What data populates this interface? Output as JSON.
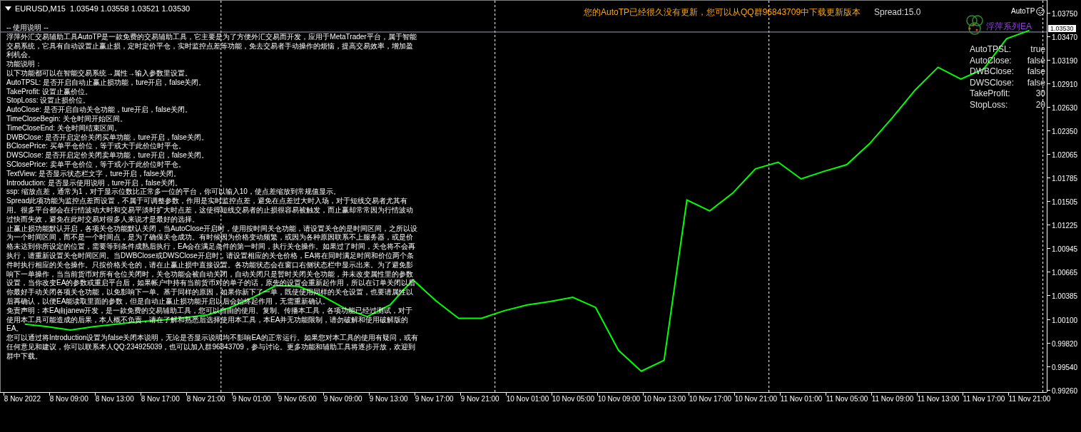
{
  "chart_header": {
    "title": "EURUSD,M15  1.03549 1.03558 1.03521 1.03530"
  },
  "update_notice": "您的AutoTP已经很久没有更新，您可以从QQ群96843709中下载更新版本",
  "spread": "Spread:15.0",
  "ea_name": "AutoTP",
  "logo_text": "浮萍系列EA",
  "instructions": [
    "-- 使用说明 --",
    "浮萍外汇交易辅助工具AutoTP是一款免费的交易辅助工具，它主要是为了方便外汇交易而开发，应用于MetaTrader平台，属于智能交易系统，它具有自动设置止赢止损，定时定价平仓，实时监控点差等功能，免去交易者手动操作的烦恼，提高交易效率，增加盈利机会。",
    "功能说明：",
    "以下功能都可以在智能交易系统→属性→输入参数里设置。",
    "AutoTPSL: 是否开启自动止赢止损功能，ture开启，false关闭。",
    "TakeProfit: 设置止赢价位。",
    "StopLoss: 设置止损价位。",
    "AutoClose: 是否开启自动关仓功能，ture开启，false关闭。",
    "TimeCloseBegin: 关仓时间开始区间。",
    "TimeCloseEnd: 关仓时间结束区间。",
    "DWBClose: 是否开启定价关闭买单功能，ture开启，false关闭。",
    "BClosePrice: 买单平仓价位，等于或大于此价位时平仓。",
    "DWSClose: 是否开启定价关闭卖单功能，ture开启，false关闭。",
    "SClosePrice: 卖单平仓价位，等于或小于此价位时平仓。",
    "TextView: 是否显示状态栏文字，ture开启，false关闭。",
    "Introduction: 是否显示使用说明，ture开启，false关闭。",
    "ssp: 缩放点差，通常为1，对于显示位数比正常多一位的平台，你可以输入10，使点差缩放到常规值显示。",
    "Spread此项功能为监控点差而设置，不属于可调整参数，作用是实时监控点差，避免在点差过大时入场，对于短线交易者尤其有用。很多平台都会在行情波动大时和交易平淡时扩大时点差，这使得短线交易者的止损很容易被触发，而止赢却常常因为行情波动过快而失效，避免在此时交易对很多人来说才是最好的选择。",
    "止赢止损功能默认开启，各项关仓功能默认关闭，当AutoClose开启时，使用按时间关仓功能，请设置关仓的是时间区间，之所以设为一个时间区间，而不是一个时间点，是为了确保关仓成功。有时候因为价格变动频繁，或因为各种原因联系不上服务器，或是价格未达到你所设定的位置，需要等到条件成熟后执行，EA会在满足条件的第一时间，执行关仓操作。如果过了时间，关仓将不会再执行，请重新设置关仓时间区间。当DWBClose或DWSClose开启时，请设置相应的关仓价格，EA将在同时满足时间和价位两个条件时执行相应的关仓操作。只按价格关仓的，请在止赢止损中直接设置。各功能状态会在窗口右侧状态栏中显示出来。为了避免影响下一单操作，当当前货币对所有仓位关闭时，关仓功能会被自动关闭，自动关闭只是暂时关闭关仓功能，并未改变属性里的参数设置，当你改变EA的参数或重启平台后，如果帐户中持有当前货币对的单子的话，原先的设置会重新起作用，所以在订单关闭以后你最好手动关闭各项关仓功能，以免影响下一单。基于同样的原因，如果你新下了一单，既使使用同样的关仓设置，也要请属性以后再确认，以便EA能读取里面的参数，但是自动止赢止损功能开启以后会始终起作用，无需重新确认。",
    "免责声明：本EA由janew开发，是一款免费的交易辅助工具，您可以自由的使用、复制、传播本工具，各项功能已经过测试，对于使用本工具可能造成的后果，本人概不负责，请在了解和熟悉后选择使用本工具，本EA并无功能限制，请勿破解和使用破解版的EA。",
    "您可以通过将Introduction设置为false关闭本说明，无论是否显示说明均不影响EA的正常运行。如果您对本工具的使用有疑问，或有任何意见和建议，你可以联系本人QQ:234925039，也可以加入群96843709，参与讨论。更多功能和辅助工具将逐步开放，欢迎到群中下载。"
  ],
  "status_panel": [
    {
      "label": "AutoTPSL:",
      "value": "true"
    },
    {
      "label": "AutoClose:",
      "value": "false"
    },
    {
      "label": "DWBClose:",
      "value": "false"
    },
    {
      "label": "DWSClose:",
      "value": "false"
    },
    {
      "label": "TakeProfit:",
      "value": "30"
    },
    {
      "label": "StopLoss:",
      "value": "20"
    }
  ],
  "current_price": "1.03530",
  "chart_data": {
    "type": "line",
    "categories": [
      "8 Nov 2022",
      null,
      "8 Nov 09:00",
      null,
      "8 Nov 13:00",
      null,
      "8 Nov 17:00",
      null,
      "8 Nov 21:00",
      null,
      "9 Nov 01:00",
      null,
      "9 Nov 05:00",
      null,
      "9 Nov 09:00",
      null,
      "9 Nov 13:00",
      null,
      "9 Nov 17:00",
      null,
      "9 Nov 21:00",
      null,
      "10 Nov 01:00",
      null,
      "10 Nov 05:00",
      null,
      "10 Nov 09:00",
      null,
      "10 Nov 13:00",
      null,
      "10 Nov 17:00",
      null,
      "10 Nov 21:00",
      null,
      "11 Nov 01:00",
      null,
      "11 Nov 05:00",
      null,
      "11 Nov 09:00",
      null,
      "11 Nov 13:00",
      null,
      "11 Nov 17:00",
      null,
      "11 Nov 21:00",
      null
    ],
    "series": [
      {
        "color": "#00ff00",
        "values": [
          1.0005,
          1.0002,
          0.9998,
          1.0002,
          1.0005,
          1.0008,
          1.001,
          1.0013,
          1.0016,
          1.0025,
          1.0037,
          1.0051,
          1.005,
          1.0039,
          1.0024,
          1.0014,
          1.0028,
          1.0058,
          1.0033,
          1.0012,
          1.0012,
          1.0021,
          1.0028,
          1.0032,
          1.0037,
          1.0025,
          0.9974,
          0.9949,
          0.9962,
          1.0153,
          1.014,
          1.0161,
          1.019,
          1.0198,
          1.0178,
          1.0187,
          1.0195,
          1.022,
          1.0251,
          1.0284,
          1.0311,
          1.0297,
          1.0309,
          1.0345,
          1.0355,
          null
        ]
      }
    ],
    "ref_lines": [
      {
        "axis": "y",
        "value": 1.0353
      }
    ],
    "ylim": [
      0.99233,
      1.03903
    ],
    "yticks": [
      {
        "value": 1.0375,
        "label": "1.03750"
      },
      {
        "value": 1.0347,
        "label": "1.03470"
      },
      {
        "value": 1.0319,
        "label": "1.03190"
      },
      {
        "value": 1.0291,
        "label": "1.02910"
      },
      {
        "value": 1.0263,
        "label": "1.02630"
      },
      {
        "value": 1.0235,
        "label": "1.02350"
      },
      {
        "value": 1.02065,
        "label": "1.02065"
      },
      {
        "value": 1.01785,
        "label": "1.01785"
      },
      {
        "value": 1.01505,
        "label": "1.01505"
      },
      {
        "value": 1.01225,
        "label": "1.01225"
      },
      {
        "value": 1.00945,
        "label": "1.00945"
      },
      {
        "value": 1.00665,
        "label": "1.00665"
      },
      {
        "value": 1.00385,
        "label": "1.00385"
      },
      {
        "value": 1.001,
        "label": "1.00100"
      },
      {
        "value": 0.9982,
        "label": "0.99820"
      },
      {
        "value": 0.9954,
        "label": "0.99540"
      },
      {
        "value": 0.9926,
        "label": "0.99260"
      }
    ]
  }
}
